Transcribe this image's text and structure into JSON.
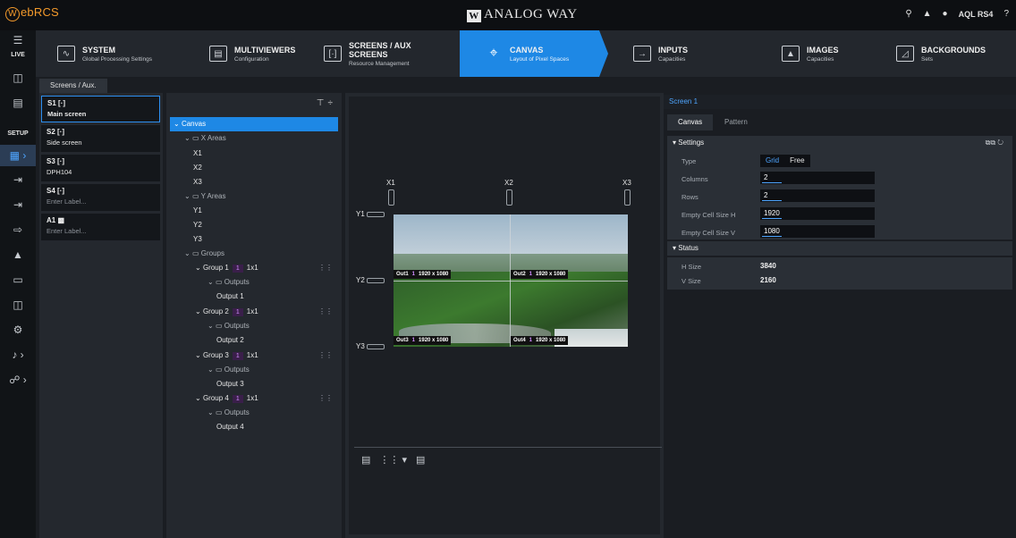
{
  "app": {
    "logo_w": "W",
    "logo_text": "ebRCS",
    "brand_mark": "W",
    "brand": "ANALOG WAY",
    "user": "AQL RS4"
  },
  "top_icons": {
    "search": "⌕",
    "bell": "🔔",
    "info": "ℹ",
    "help": "?"
  },
  "rail": {
    "live": "LIVE",
    "setup": "SETUP"
  },
  "nav": [
    {
      "title": "SYSTEM",
      "sub": "Global Processing Settings",
      "icon": "∿"
    },
    {
      "title": "MULTIVIEWERS",
      "sub": "Configuration",
      "icon": "▭"
    },
    {
      "title": "SCREENS / AUX",
      "title2": "SCREENS",
      "sub": "Resource Management",
      "icon": "[·]"
    },
    {
      "title": "CANVAS",
      "sub": "Layout of Pixel Spaces",
      "icon": "#"
    },
    {
      "title": "INPUTS",
      "sub": "Capacities",
      "icon": "→"
    },
    {
      "title": "IMAGES",
      "sub": "Capacities",
      "icon": "▲"
    },
    {
      "title": "BACKGROUNDS",
      "sub": "Sets",
      "icon": "◿"
    }
  ],
  "subtab": "Screens / Aux.",
  "screens": [
    {
      "id": "S1",
      "label": "Main screen",
      "placeholder": false
    },
    {
      "id": "S2",
      "label": "Side screen",
      "placeholder": false
    },
    {
      "id": "S3",
      "label": "DPH104",
      "placeholder": false
    },
    {
      "id": "S4",
      "label": "Enter Label...",
      "placeholder": true
    },
    {
      "id": "A1",
      "label": "Enter Label...",
      "placeholder": true
    }
  ],
  "tree": {
    "root": "Canvas",
    "x_areas": "X Areas",
    "x": [
      "X1",
      "X2",
      "X3"
    ],
    "y_areas": "Y Areas",
    "y": [
      "Y1",
      "Y2",
      "Y3"
    ],
    "groups_label": "Groups",
    "outputs_label": "Outputs",
    "groups": [
      {
        "name": "Group 1",
        "badge": "1",
        "size": "1x1",
        "output": "Output 1"
      },
      {
        "name": "Group 2",
        "badge": "1",
        "size": "1x1",
        "output": "Output 2"
      },
      {
        "name": "Group 3",
        "badge": "1",
        "size": "1x1",
        "output": "Output 3"
      },
      {
        "name": "Group 4",
        "badge": "1",
        "size": "1x1",
        "output": "Output 4"
      }
    ]
  },
  "canvas": {
    "x_markers": [
      "X1",
      "X2",
      "X3"
    ],
    "y_markers": [
      "Y1",
      "Y2",
      "Y3"
    ],
    "outputs": [
      {
        "name": "Out1",
        "num": "1",
        "res": "1920 x 1080"
      },
      {
        "name": "Out2",
        "num": "1",
        "res": "1920 x 1080"
      },
      {
        "name": "Out3",
        "num": "1",
        "res": "1920 x 1080"
      },
      {
        "name": "Out4",
        "num": "1",
        "res": "1920 x 1080"
      }
    ]
  },
  "props": {
    "screen_title": "Screen 1",
    "tabs": [
      "Canvas",
      "Pattern"
    ],
    "settings_label": "Settings",
    "type_label": "Type",
    "type_options": [
      "Grid",
      "Free"
    ],
    "columns_label": "Columns",
    "columns": "2",
    "rows_label": "Rows",
    "rows": "2",
    "cell_h_label": "Empty Cell Size H",
    "cell_h": "1920",
    "cell_v_label": "Empty Cell Size V",
    "cell_v": "1080",
    "status_label": "Status",
    "h_size_label": "H Size",
    "h_size": "3840",
    "v_size_label": "V Size",
    "v_size": "2160"
  }
}
